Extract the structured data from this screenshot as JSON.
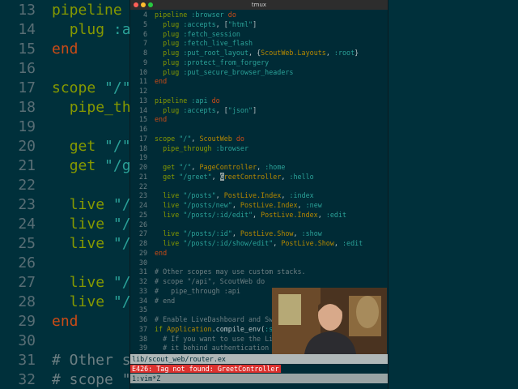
{
  "window": {
    "title": "tmux",
    "traffic_lights": [
      "#ff5f57",
      "#febc2e",
      "#28c840"
    ]
  },
  "background_editor": {
    "lines": [
      {
        "num": "13",
        "text": "pipeline :api do"
      },
      {
        "num": "14",
        "text": "  plug :accepts, [\"json\"]"
      },
      {
        "num": "15",
        "text": "end"
      },
      {
        "num": "16",
        "text": ""
      },
      {
        "num": "17",
        "text": "scope \"/\", ScoutWeb do"
      },
      {
        "num": "18",
        "text": "  pipe_through :browser"
      },
      {
        "num": "19",
        "text": ""
      },
      {
        "num": "20",
        "text": "  get \"/\", PageController, :home"
      },
      {
        "num": "21",
        "text": "  get \"/greet\", GreetController, :hello"
      },
      {
        "num": "22",
        "text": ""
      },
      {
        "num": "23",
        "text": "  live \"/posts\", PostLive.Index, :index"
      },
      {
        "num": "24",
        "text": "  live \"/posts/new\", PostLive.Index, :new"
      },
      {
        "num": "25",
        "text": "  live \"/posts/:id/edit\", PostLive.Index, :edit"
      },
      {
        "num": "26",
        "text": ""
      },
      {
        "num": "27",
        "text": "  live \"/posts/:id\", PostLive.Show, :show"
      },
      {
        "num": "28",
        "text": "  live \"/posts/:id/show/edit\", PostLive.Show, :edit"
      },
      {
        "num": "29",
        "text": "end"
      },
      {
        "num": "30",
        "text": ""
      },
      {
        "num": "31",
        "text": "# Other scopes may use custom stacks."
      },
      {
        "num": "32",
        "text": "# scope \"/api\", ScoutWeb do"
      }
    ]
  },
  "editor": {
    "lines": [
      {
        "num": "4",
        "text": "pipeline :browser do"
      },
      {
        "num": "5",
        "text": "  plug :accepts, [\"html\"]"
      },
      {
        "num": "6",
        "text": "  plug :fetch_session"
      },
      {
        "num": "7",
        "text": "  plug :fetch_live_flash"
      },
      {
        "num": "8",
        "text": "  plug :put_root_layout, {ScoutWeb.Layouts, :root}"
      },
      {
        "num": "9",
        "text": "  plug :protect_from_forgery"
      },
      {
        "num": "10",
        "text": "  plug :put_secure_browser_headers"
      },
      {
        "num": "11",
        "text": "end"
      },
      {
        "num": "12",
        "text": ""
      },
      {
        "num": "13",
        "text": "pipeline :api do"
      },
      {
        "num": "14",
        "text": "  plug :accepts, [\"json\"]"
      },
      {
        "num": "15",
        "text": "end"
      },
      {
        "num": "16",
        "text": ""
      },
      {
        "num": "17",
        "text": "scope \"/\", ScoutWeb do"
      },
      {
        "num": "18",
        "text": "  pipe_through :browser"
      },
      {
        "num": "19",
        "text": ""
      },
      {
        "num": "20",
        "text": "  get \"/\", PageController, :home"
      },
      {
        "num": "21",
        "text": "  get \"/greet\", GreetController, :hello"
      },
      {
        "num": "22",
        "text": ""
      },
      {
        "num": "23",
        "text": "  live \"/posts\", PostLive.Index, :index"
      },
      {
        "num": "24",
        "text": "  live \"/posts/new\", PostLive.Index, :new"
      },
      {
        "num": "25",
        "text": "  live \"/posts/:id/edit\", PostLive.Index, :edit"
      },
      {
        "num": "26",
        "text": ""
      },
      {
        "num": "27",
        "text": "  live \"/posts/:id\", PostLive.Show, :show"
      },
      {
        "num": "28",
        "text": "  live \"/posts/:id/show/edit\", PostLive.Show, :edit"
      },
      {
        "num": "29",
        "text": "end"
      },
      {
        "num": "30",
        "text": ""
      },
      {
        "num": "31",
        "text": "# Other scopes may use custom stacks."
      },
      {
        "num": "32",
        "text": "# scope \"/api\", ScoutWeb do"
      },
      {
        "num": "33",
        "text": "#   pipe_through :api"
      },
      {
        "num": "34",
        "text": "# end"
      },
      {
        "num": "35",
        "text": ""
      },
      {
        "num": "36",
        "text": "# Enable LiveDashboard and Sw"
      },
      {
        "num": "37",
        "text": "if Application.compile_env(:s"
      },
      {
        "num": "38",
        "text": "  # If you want to use the Li"
      },
      {
        "num": "39",
        "text": "  # it behind authentication a"
      }
    ],
    "cursor_line": "21"
  },
  "statusline": {
    "file_path": "lib/scout_web/router.ex"
  },
  "error": {
    "message": "E426: Tag not found: GreetController"
  },
  "tmux": {
    "window_label": "1:vim*Z"
  },
  "colors": {
    "background": "#002b36",
    "keyword": "#859900",
    "do_end": "#cb4b16",
    "symbol_string": "#2aa198",
    "module": "#b58900",
    "comment": "#6c7f83",
    "error_bg": "#dc322f"
  }
}
